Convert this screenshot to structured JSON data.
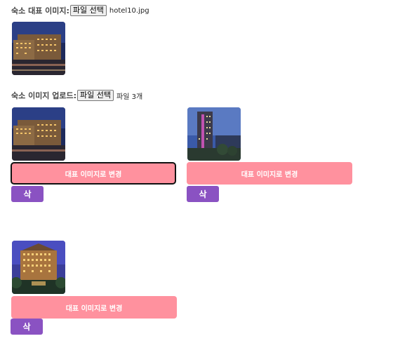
{
  "representative": {
    "label": "숙소 대표 이미지:",
    "file_button": "파일 선택",
    "file_name": "hotel10.jpg"
  },
  "upload": {
    "label": "숙소 이미지 업로드:",
    "file_button": "파일 선택",
    "file_count": "파일 3개"
  },
  "images": [
    {
      "main_label": "대표 이미지로 변경",
      "delete_label": "삭"
    },
    {
      "main_label": "대표 이미지로 변경",
      "delete_label": "삭"
    },
    {
      "main_label": "대표 이미지로 변경",
      "delete_label": "삭"
    }
  ],
  "colors": {
    "main_button": "#ff919e",
    "delete_button": "#8a52c2"
  }
}
